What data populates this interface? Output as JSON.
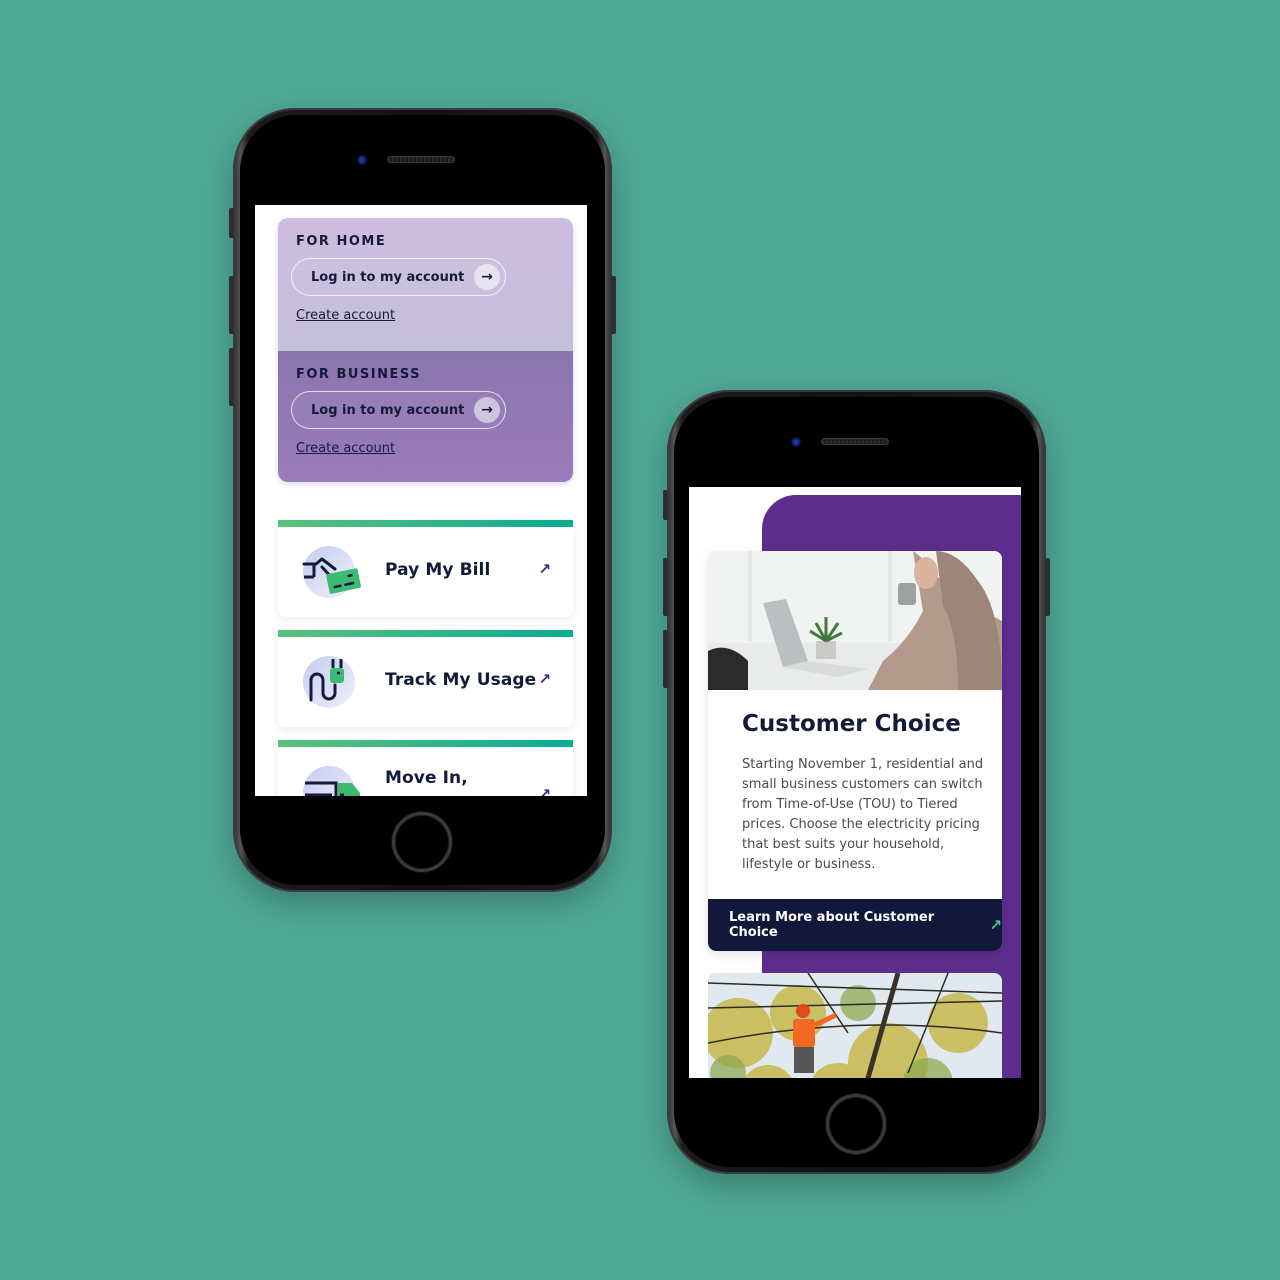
{
  "colors": {
    "background": "#4fa896",
    "accent_purple": "#5d2d8e",
    "navy": "#141a3a",
    "green_gradient_start": "#5cc07a",
    "green_gradient_end": "#0aab95",
    "cta_arrow": "#3ecf8e"
  },
  "phone1": {
    "login_panel": {
      "home": {
        "label": "FOR HOME",
        "login_button": "Log in to my account",
        "login_icon": "arrow-right-icon",
        "create_link": "Create account"
      },
      "business": {
        "label": "FOR BUSINESS",
        "login_button": "Log in to my account",
        "login_icon": "arrow-right-icon",
        "create_link": "Create account"
      }
    },
    "quick_links": [
      {
        "title": "Pay My Bill",
        "icon": "credit-card-hand-icon",
        "link_icon": "external-arrow-icon"
      },
      {
        "title": "Track My Usage",
        "icon": "plug-cable-icon",
        "link_icon": "external-arrow-icon"
      },
      {
        "title": "Move In,",
        "icon": "moving-truck-icon",
        "link_icon": "external-arrow-icon"
      }
    ],
    "arrow_glyph": "→",
    "ext_glyph": "↗"
  },
  "phone2": {
    "feature": {
      "image": "woman-at-laptop-photo",
      "title": "Customer Choice",
      "body": "Starting November 1, residential and small business customers can switch from Time-of-Use (TOU) to Tiered prices. Choose the electricity pricing that best suits your household, lifestyle or business.",
      "cta": "Learn More about Customer Choice",
      "cta_glyph": "↗"
    },
    "next_card_image": "line-worker-in-trees-photo"
  }
}
